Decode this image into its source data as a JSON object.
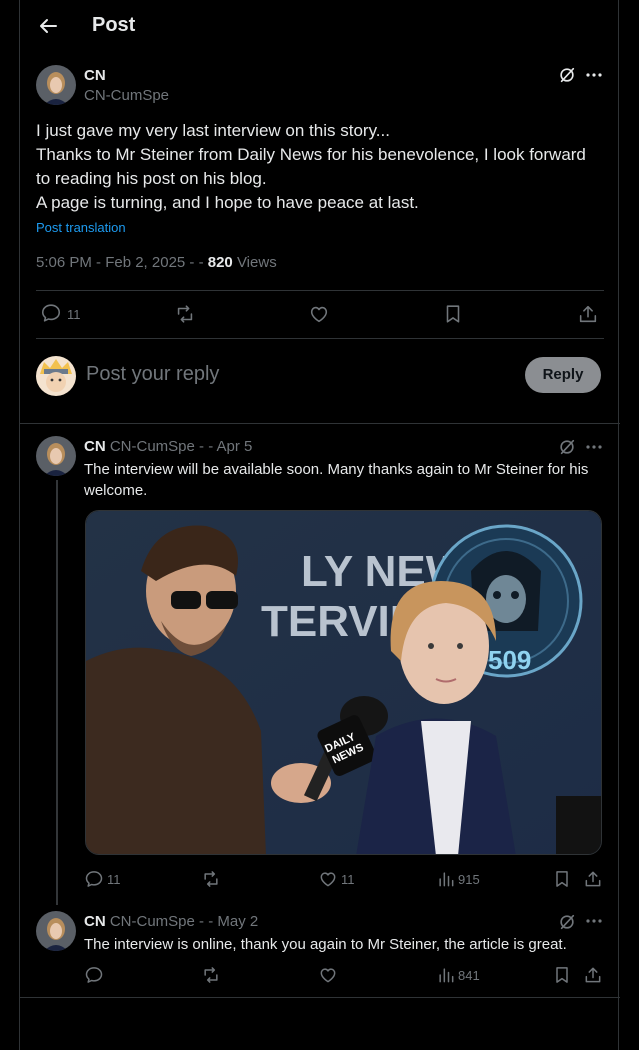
{
  "header": {
    "title": "Post"
  },
  "main_post": {
    "name": "CN",
    "handle": "CN-CumSpe",
    "lines": [
      "I just gave my very last interview on this story...",
      "Thanks to Mr Steiner from Daily News for his benevolence, I look forward",
      "to reading his post on his blog.",
      "A page is turning, and I hope to have peace at last."
    ],
    "translation_link": "Post translation",
    "timestamp": "5:06 PM - Feb 2, 2025 - - ",
    "views_count": "820",
    "views_label": " Views",
    "reply_count": "11"
  },
  "reply_box": {
    "placeholder": "Post your reply",
    "button": "Reply"
  },
  "replies": [
    {
      "name": "CN",
      "meta": "CN-CumSpe - - Apr 5",
      "text_lines": [
        "The interview will be available soon. Many thanks again to Mr Steiner for his",
        "welcome."
      ],
      "image_text": {
        "line1": "LY NEWS",
        "line2": "TERVIEW",
        "mic_line1": "DAILY",
        "mic_line2": "NEWS",
        "badge_number": "509"
      },
      "reply_count": "11",
      "like_count": "11",
      "views": "915"
    },
    {
      "name": "CN",
      "meta": "CN-CumSpe - - May 2",
      "text_lines": [
        "The interview is online, thank you again to Mr Steiner, the article is great."
      ],
      "views": "841"
    }
  ],
  "colors": {
    "background": "#000000",
    "text": "#e7e9ea",
    "muted": "#71767b",
    "link": "#1d9bf0",
    "border": "#2f3336"
  }
}
